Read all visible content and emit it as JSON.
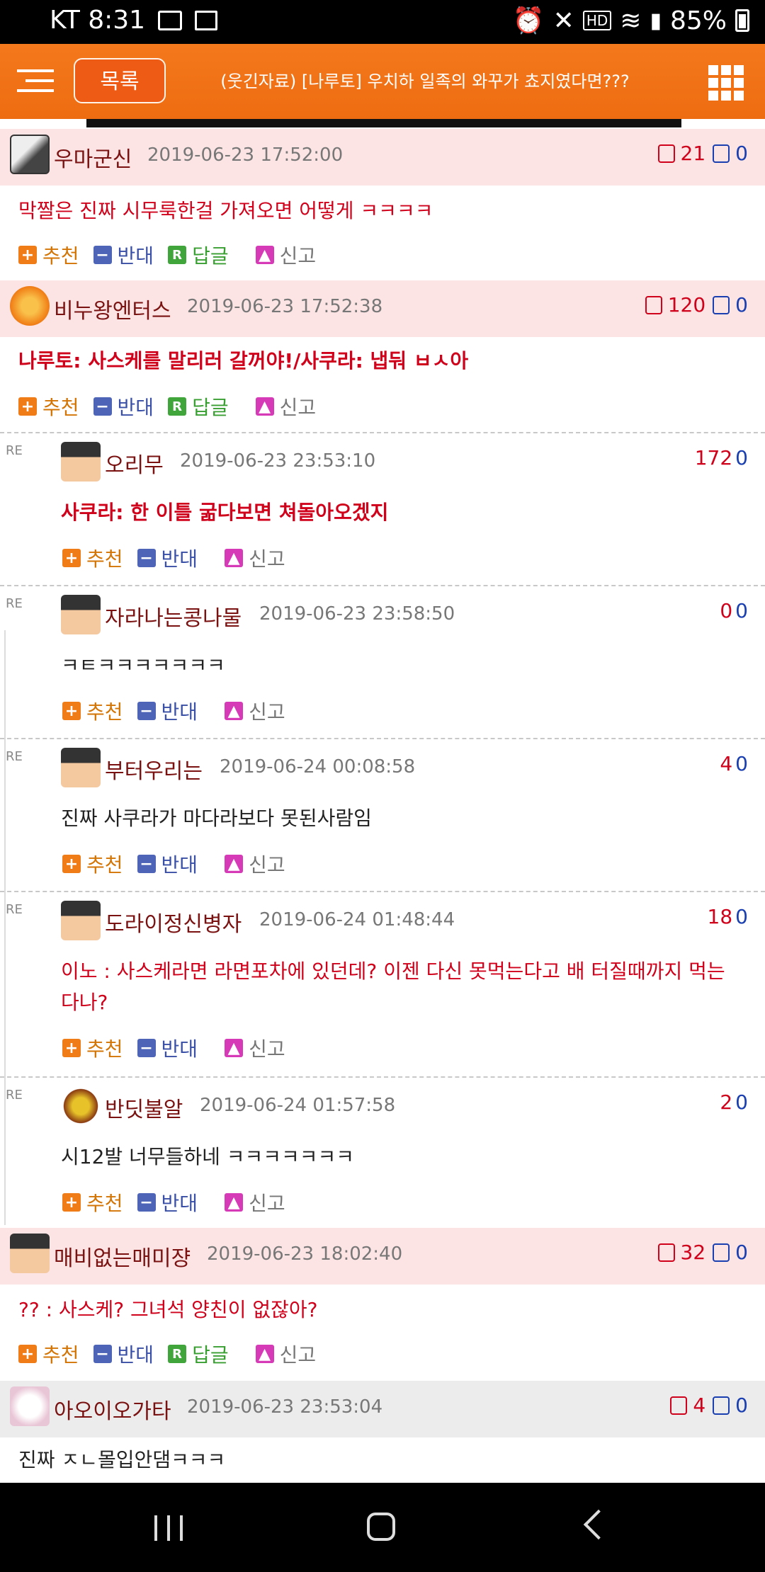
{
  "status_bar": {
    "carrier_time": "KT 8:31",
    "battery": "85%"
  },
  "header": {
    "list_button": "목록",
    "title": "(웃긴자료) [나루토] 우치하 일족의 와꾸가 쵸지였다면???"
  },
  "colors": {
    "accent": "#f27417",
    "comment_bg": "#fde4e4",
    "vote_up": "#d0021b",
    "vote_down": "#1a3fb0"
  },
  "action_labels": {
    "recommend": "추천",
    "oppose": "반대",
    "reply": "답글",
    "report": "신고"
  },
  "comments": [
    {
      "nick": "우마군신",
      "date": "2019-06-23 17:52:00",
      "up": "21",
      "down": "0",
      "text": "막짤은 진짜 시무룩한걸 가져오면 어떻게 ㅋㅋㅋㅋ"
    },
    {
      "nick": "비누왕엔터스",
      "date": "2019-06-23 17:52:38",
      "up": "120",
      "down": "0",
      "text": "나루토: 사스케를 말리러 갈꺼야!/사쿠라: 냅둬 ㅂㅅ아"
    },
    {
      "nick": "매비없는매미쟝",
      "date": "2019-06-23 18:02:40",
      "up": "32",
      "down": "0",
      "text": "?? : 사스케? 그녀석 양친이 없잖아?"
    },
    {
      "nick": "아오이오가타",
      "date": "2019-06-23 23:53:04",
      "up": "4",
      "down": "0",
      "text": "진짜 ㅈㄴ몰입안댐ㅋㅋㅋ"
    }
  ],
  "replies": [
    {
      "re": "RE",
      "nick": "오리무",
      "date": "2019-06-23 23:53:10",
      "up": "172",
      "down": "0",
      "text": "사쿠라: 한 이틀 굶다보면 쳐돌아오겠지"
    },
    {
      "re": "RE",
      "nick": "자라나는콩나물",
      "date": "2019-06-23 23:58:50",
      "up": "0",
      "down": "0",
      "text": "ㅋㅌㅋㅋㅋㅋㅋㅋㅋ"
    },
    {
      "re": "RE",
      "nick": "부터우리는",
      "date": "2019-06-24 00:08:58",
      "up": "4",
      "down": "0",
      "text": "진짜 사쿠라가 마다라보다 못된사람임"
    },
    {
      "re": "RE",
      "nick": "도라이정신병자",
      "date": "2019-06-24 01:48:44",
      "up": "18",
      "down": "0",
      "text": "이노 : 사스케라면 라면포차에 있던데? 이젠 다신 못먹는다고 배 터질때까지 먹는다나?"
    },
    {
      "re": "RE",
      "nick": "반딧불알",
      "date": "2019-06-24 01:57:58",
      "up": "2",
      "down": "0",
      "text": "시12발 너무들하네 ㅋㅋㅋㅋㅋㅋㅋ"
    }
  ]
}
